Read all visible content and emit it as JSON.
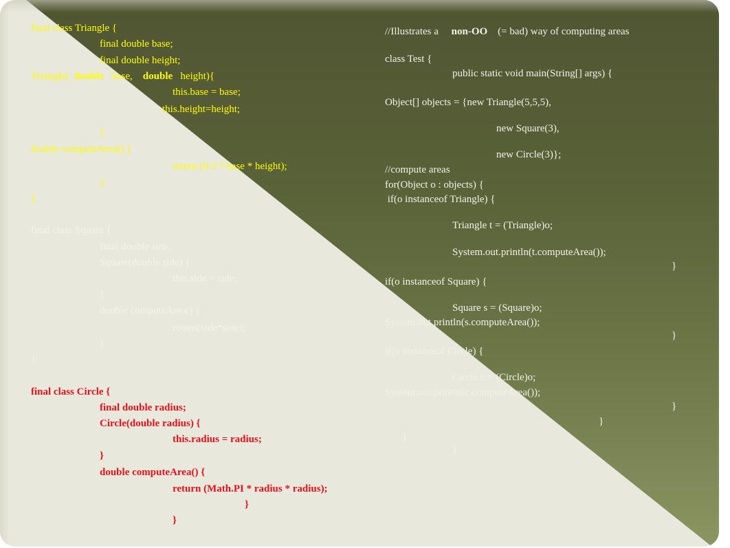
{
  "slide": {
    "colors": {
      "olive_dark": "#4f5532",
      "olive_light": "#8c9663",
      "background_light": "#e8e8dc",
      "triangle_code": "#ffff00",
      "square_code": "#f4f4ec",
      "circle_code": "#e8101a",
      "test_code": "#f2f2ea"
    },
    "left_code": {
      "triangle": {
        "class_decl": "final class Triangle {",
        "field_base": "final double base;",
        "field_height": "final double height;",
        "ctor_name": "Triangle(",
        "ctor_kw1": "double",
        "ctor_p1": "base,",
        "ctor_kw2": "double",
        "ctor_p2": "height){",
        "assign_base": "this.base = base;",
        "assign_height": "this.height=height;",
        "ctor_close": "}",
        "method_decl": "double computeArea() {",
        "method_return": "return (0.5 * base * height);",
        "method_close": "}",
        "class_close": "}"
      },
      "square": {
        "class_decl": "final class Square {",
        "field_side": "final double side;",
        "ctor_decl": "Square(double side) {",
        "assign_side": "this.side = side;",
        "ctor_close": "}",
        "method_decl": "double computeArea() {",
        "method_return": "return(side*side);",
        "method_close": "}",
        "class_close": "}"
      },
      "circle": {
        "class_decl": "final class Circle {",
        "field_radius": "final double radius;",
        "ctor_decl": "Circle(double radius) {",
        "assign_radius": "this.radius = radius;",
        "ctor_close": "}",
        "method_decl": "double computeArea() {",
        "method_return": "return (Math.PI * radius * radius);",
        "method_close": "}",
        "class_close": "}"
      }
    },
    "right_code": {
      "comment_prefix": "//Illustrates a",
      "comment_bold": "non-OO",
      "comment_suffix": "(= bad) way of computing areas",
      "class_decl": "class Test {",
      "main_decl": "public static void main(String[] args) {",
      "objects_decl": "Object[] objects = {new Triangle(5,5,5),",
      "new_square": "new Square(3),",
      "new_circle": "new Circle(3)};",
      "compute_comment": "//compute areas",
      "for_loop": "for(Object o : objects) {",
      "if_triangle": " if(o instanceof Triangle) {",
      "cast_triangle": "Triangle t = (Triangle)o;",
      "print_triangle": "System.out.println(t.computeArea());",
      "close_triangle": "}",
      "if_square": "if(o instanceof Square) {",
      "cast_square": "Square s = (Square)o;",
      "print_square": "System.out.println(s.computeArea());",
      "close_square": "}",
      "if_circle": "if(o instanceof Circle) {",
      "cast_circle": "Circle c = (Circle)o;",
      "print_circle": "System.out.println(c.computeArea());",
      "close_circle": "}",
      "close_for": "}",
      "close_main": "}",
      "close_class": "}"
    }
  }
}
